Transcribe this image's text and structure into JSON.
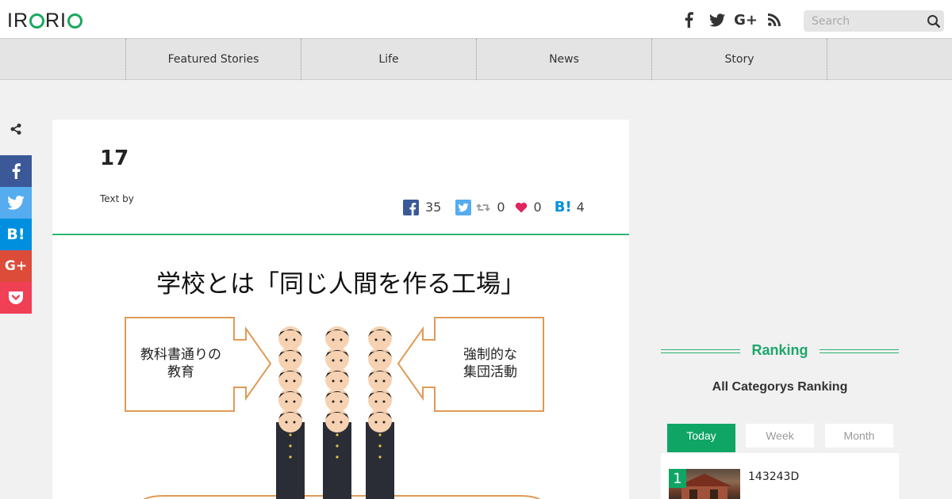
{
  "header": {
    "logo": "IRORIO",
    "search_placeholder": "Search",
    "social_icons": [
      "facebook-icon",
      "twitter-icon",
      "google-plus-icon",
      "rss-icon"
    ]
  },
  "nav": {
    "items": [
      {
        "label": "Featured Stories"
      },
      {
        "label": "Life"
      },
      {
        "label": "News"
      },
      {
        "label": "Story"
      }
    ]
  },
  "share_sidebar": {
    "items": [
      {
        "icon": "facebook-icon",
        "color": "#3b5998",
        "label": "f"
      },
      {
        "icon": "twitter-icon",
        "color": "#55acee",
        "label": ""
      },
      {
        "icon": "hatena-icon",
        "color": "#008fde",
        "label": "B!"
      },
      {
        "icon": "google-plus-icon",
        "color": "#dd4b39",
        "label": "G+"
      },
      {
        "icon": "pocket-icon",
        "color": "#ef4056",
        "label": ""
      }
    ]
  },
  "article": {
    "title": "17",
    "text_by": "Text by",
    "counts": {
      "facebook": "35",
      "retweet": "0",
      "like": "0",
      "hatena": "4"
    },
    "accent": "#2bb673",
    "illustration": {
      "title": "学校とは「同じ人間を作る工場」",
      "left_box": "教科書通りの\n教育",
      "right_box": "強制的な\n集団活動"
    }
  },
  "ranking": {
    "heading": "Ranking",
    "subheading": "All Categorys Ranking",
    "tabs": [
      {
        "label": "Today",
        "active": true
      },
      {
        "label": "Week",
        "active": false
      },
      {
        "label": "Month",
        "active": false
      }
    ],
    "items": [
      {
        "rank": "1",
        "title": "143243D"
      }
    ],
    "accent": "#0fa565"
  }
}
